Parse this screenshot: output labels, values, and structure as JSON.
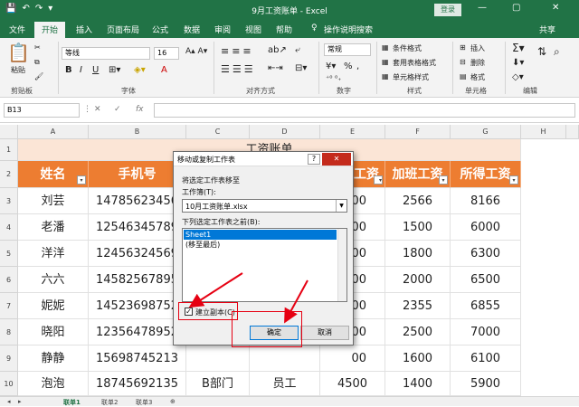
{
  "window": {
    "title": "9月工资账单 - Excel",
    "login": "登录",
    "controls": [
      "—",
      "▢",
      "✕"
    ]
  },
  "menu": {
    "items": [
      "文件",
      "开始",
      "插入",
      "页面布局",
      "公式",
      "数据",
      "审阅",
      "视图",
      "帮助"
    ],
    "active_index": 1,
    "tell_me": "操作说明搜索",
    "share": "共享"
  },
  "ribbon": {
    "paste": "粘贴",
    "clipboard": "剪贴板",
    "font_name": "等线",
    "font_size": "16",
    "font_group": "字体",
    "font_buttons": [
      "B",
      "I",
      "U",
      "A"
    ],
    "alignment_group": "对齐方式",
    "number_format": "常规",
    "number_symbols": [
      "%",
      ","
    ],
    "number_group": "数字",
    "styles": [
      "条件格式",
      "套用表格格式",
      "单元格样式"
    ],
    "styles_group": "样式",
    "cells": [
      "插入",
      "删除",
      "格式"
    ],
    "cells_group": "单元格",
    "editing_group": "编辑"
  },
  "formula_bar": {
    "name_box": "B13",
    "fx": "fx"
  },
  "sheet": {
    "columns": [
      "A",
      "B",
      "C",
      "D",
      "E",
      "F",
      "G",
      "H"
    ],
    "rows": [
      "1",
      "2",
      "3",
      "4",
      "5",
      "6",
      "7",
      "8",
      "9",
      "10"
    ],
    "title": "工资账单",
    "headers": [
      "姓名",
      "手机号",
      "",
      "",
      "工资",
      "加班工资",
      "所得工资"
    ],
    "data": [
      [
        "刘芸",
        "14785623456",
        "",
        "",
        "00",
        "2566",
        "8166"
      ],
      [
        "老潘",
        "12546345789",
        "",
        "",
        "00",
        "1500",
        "6000"
      ],
      [
        "洋洋",
        "12456324569",
        "",
        "",
        "00",
        "1800",
        "6300"
      ],
      [
        "六六",
        "14582567895",
        "",
        "",
        "00",
        "2000",
        "6500"
      ],
      [
        "妮妮",
        "14523698752",
        "",
        "",
        "00",
        "2355",
        "6855"
      ],
      [
        "晓阳",
        "12356478952",
        "",
        "",
        "00",
        "2500",
        "7000"
      ],
      [
        "静静",
        "15698745213",
        "",
        "",
        "00",
        "1600",
        "6100"
      ],
      [
        "泡泡",
        "18745692135",
        "B部门",
        "员工",
        "4500",
        "1400",
        "5900"
      ]
    ],
    "tabs": [
      "联单1",
      "联单2",
      "联单3"
    ]
  },
  "dialog": {
    "title": "移动或复制工作表",
    "help": "?",
    "close": "✕",
    "move_label": "将选定工作表移至",
    "workbook_label": "工作簿(T):",
    "workbook_value": "10月工资账单.xlsx",
    "before_label": "下列选定工作表之前(B):",
    "list": [
      "Sheet1",
      "(移至最后)"
    ],
    "selected_index": 0,
    "copy_checkbox": "建立副本(C)",
    "copy_checked": true,
    "ok": "确定",
    "cancel": "取消"
  },
  "colors": {
    "excel_green": "#217346",
    "header_orange": "#ed7d31",
    "title_band": "#fbe5d6",
    "annotation_red": "#e60012",
    "selection_blue": "#0078d7"
  }
}
